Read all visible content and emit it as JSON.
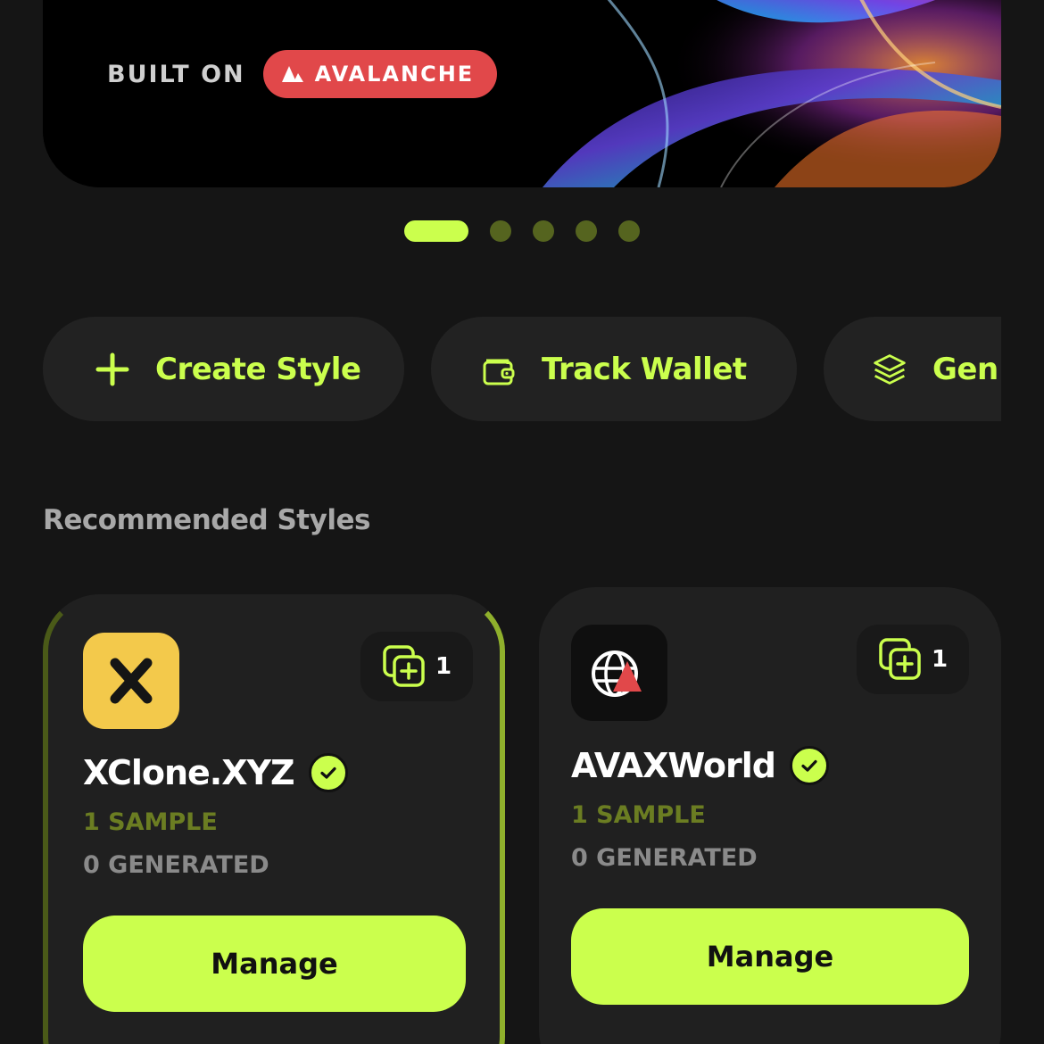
{
  "hero": {
    "built_on_label": "BUILT ON",
    "chain_label": "AVALANCHE",
    "chain_color": "#e1484a"
  },
  "pager": {
    "count": 5,
    "active_index": 0,
    "active_color": "#cbff4d",
    "inactive_color": "#55641f"
  },
  "actions": [
    {
      "label": "Create Style",
      "icon": "plus-icon"
    },
    {
      "label": "Track Wallet",
      "icon": "wallet-icon"
    },
    {
      "label": "Gen",
      "icon": "layers-icon"
    }
  ],
  "section": {
    "title": "Recommended Styles"
  },
  "cards": [
    {
      "name": "XClone.XYZ",
      "icon": "x-logo-icon",
      "count": "1",
      "samples": "1 SAMPLE",
      "generated": "0 GENERATED",
      "button": "Manage",
      "verified": true
    },
    {
      "name": "AVAXWorld",
      "icon": "globe-avax-logo-icon",
      "count": "1",
      "samples": "1 SAMPLE",
      "generated": "0 GENERATED",
      "button": "Manage",
      "verified": true
    }
  ],
  "colors": {
    "accent": "#cbff4d",
    "background": "#151515",
    "card": "#202020"
  }
}
